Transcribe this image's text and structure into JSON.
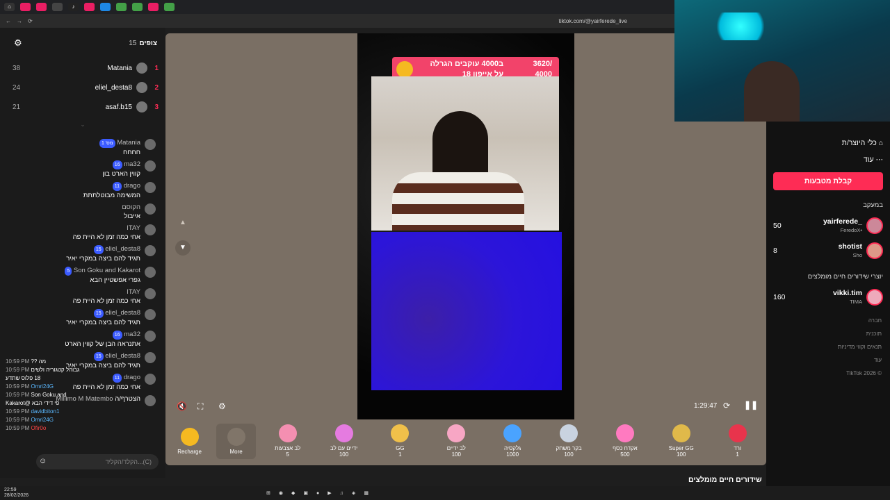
{
  "browser": {
    "url": "tiktok.com/@yairferede_live"
  },
  "viewers": {
    "count_label": "צופים",
    "count": "15",
    "list": [
      {
        "rank": "1",
        "name": "Matania",
        "score": "38"
      },
      {
        "rank": "2",
        "name": "eliel_desta8",
        "score": "24"
      },
      {
        "rank": "3",
        "name": "asaf.b15",
        "score": "21"
      }
    ]
  },
  "chat": {
    "messages": [
      {
        "user": "Matania",
        "badge": "מס' 1",
        "text": "חחחח"
      },
      {
        "user": "ma32",
        "badge": "16",
        "text": "קווין הארט בון"
      },
      {
        "user": "drago",
        "badge": "11",
        "text": "המשימה מבוטלתתת"
      },
      {
        "user": "הקוסם",
        "badge": "",
        "text": "אייבול"
      },
      {
        "user": "ITAY",
        "badge": "",
        "text": "אחי כמה זמן לא היית פה"
      },
      {
        "user": "eliel_desta8",
        "badge": "15",
        "text": "תגיד להם ביצה במקרי יאיר"
      },
      {
        "user": "Son Goku and Kakarot",
        "badge": "5",
        "text": "גפרי אפשטיין הבא"
      },
      {
        "user": "ITAY",
        "badge": "",
        "text": "אחי כמה זמן לא היית פה"
      },
      {
        "user": "eliel_desta8",
        "badge": "15",
        "text": "תגיד להם ביצה במקרי יאיר"
      },
      {
        "user": "ma32",
        "badge": "16",
        "text": "אתנראה הבן של קווין הארט"
      },
      {
        "user": "eliel_desta8",
        "badge": "15",
        "text": "תגיד להם ביצה במקרי יאיר"
      },
      {
        "user": "drago",
        "badge": "11",
        "text": "אחי כמה זמן לא היית פה"
      },
      {
        "user": "Millimo M Matembo",
        "badge": "",
        "text": "הצטרף/ה"
      }
    ],
    "overlay": [
      {
        "time": "10:59 PM",
        "text": "?? מה"
      },
      {
        "time": "10:59 PM",
        "text": "גבוהל קטגוריה ולשים 18 פלוס שתדע"
      },
      {
        "time": "10:59 PM",
        "text": "Omri24G"
      },
      {
        "time": "10:59 PM",
        "text": "Son Goku and Kakarot@ פי דידי הבא"
      },
      {
        "time": "10:59 PM",
        "text": "davidbiton1"
      },
      {
        "time": "10:59 PM",
        "text": "Omri24G"
      },
      {
        "time": "10:59 PM",
        "text": "Ofir0o"
      }
    ],
    "input_placeholder": "הקלד/הקליד...(C)"
  },
  "stream": {
    "goal_text": "ב4000 עוקבים הגרלה על אייפון 18",
    "goal_progress": "3620/",
    "goal_target": "4000",
    "duration": "1:29:47"
  },
  "gifts": [
    {
      "name": "Recharge",
      "price": ""
    },
    {
      "name": "More",
      "price": ""
    },
    {
      "name": "לב אצבעות",
      "price": "5"
    },
    {
      "name": "ידיים עם לב",
      "price": "100"
    },
    {
      "name": "GG",
      "price": "1"
    },
    {
      "name": "לב ידיים",
      "price": "100"
    },
    {
      "name": "גלקסיה",
      "price": "1000"
    },
    {
      "name": "בקר משחק",
      "price": "100"
    },
    {
      "name": "אקדח כסף",
      "price": "500"
    },
    {
      "name": "Super GG",
      "price": "100"
    },
    {
      "name": "ורד",
      "price": "1"
    }
  ],
  "sidebar": {
    "item1": "כלי היוצר/ת",
    "item2": "עוד",
    "follow_button": "קבלת מטבעות",
    "following_label": "במעקב",
    "following": [
      {
        "name": "yairferede_",
        "sub": "FeredoX•",
        "viewers": "50"
      },
      {
        "name": "shotist",
        "sub": "Sho",
        "viewers": "8"
      }
    ],
    "recommended_label": "יוצרי שידורים חיים מומלצים",
    "recommended": [
      {
        "name": "vikki.tim",
        "sub": "TIMA",
        "viewers": "160"
      }
    ],
    "links": [
      "חברה",
      "תוכנית",
      "תנאים וקווי מדיניות",
      "עוד"
    ],
    "copyright": "TikTok 2026 ©",
    "recommended_bottom": "שידורים חיים מומלצים"
  },
  "taskbar": {
    "time": "22:59",
    "date": "28/02/2026"
  }
}
